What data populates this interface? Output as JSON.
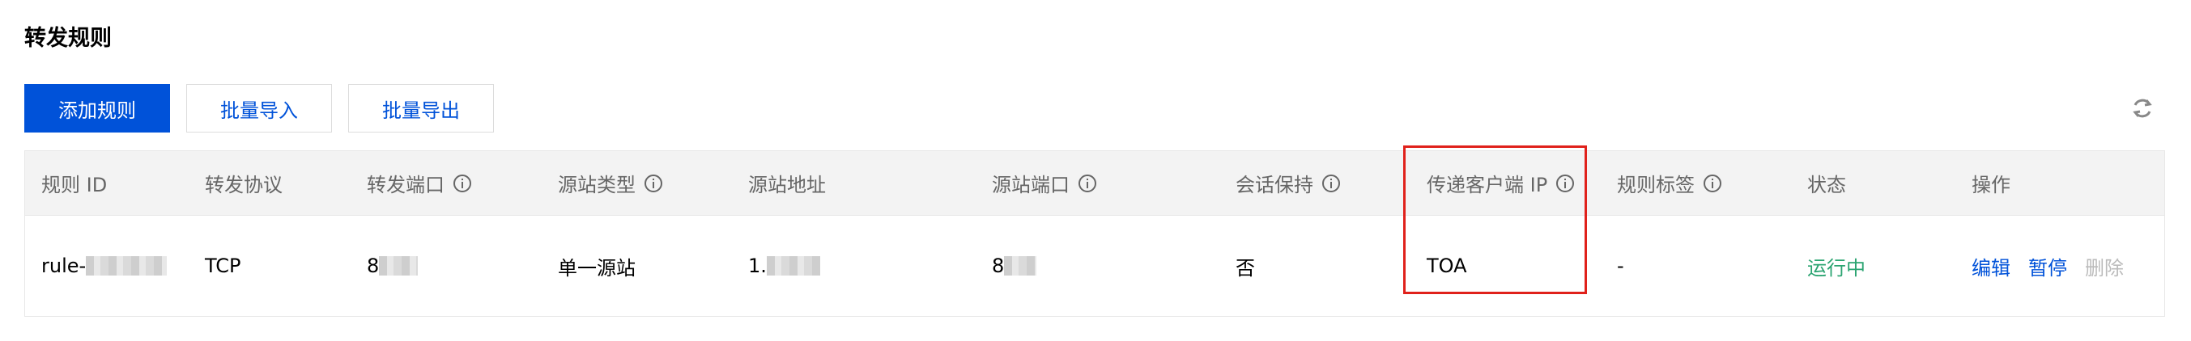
{
  "page_title": "转发规则",
  "toolbar": {
    "add_label": "添加规则",
    "import_label": "批量导入",
    "export_label": "批量导出"
  },
  "table": {
    "headers": {
      "rule_id": "规则 ID",
      "protocol": "转发协议",
      "forward_port": "转发端口",
      "origin_type": "源站类型",
      "origin_address": "源站地址",
      "origin_port": "源站端口",
      "session_persist": "会话保持",
      "client_ip": "传递客户端 IP",
      "rule_tag": "规则标签",
      "status": "状态",
      "actions": "操作"
    },
    "rows": [
      {
        "rule_id": "rule-",
        "protocol": "TCP",
        "forward_port": "8",
        "origin_type": "单一源站",
        "origin_address": "1.",
        "origin_port": "8",
        "session_persist": "否",
        "client_ip": "TOA",
        "rule_tag": "-",
        "status": "运行中",
        "action_edit": "编辑",
        "action_pause": "暂停",
        "action_delete": "删除"
      }
    ]
  },
  "colors": {
    "primary": "#0052d9",
    "status_running": "#2ba471",
    "highlight": "#e0211b"
  },
  "icons": {
    "info": "info-circle-icon",
    "refresh": "refresh-icon"
  }
}
